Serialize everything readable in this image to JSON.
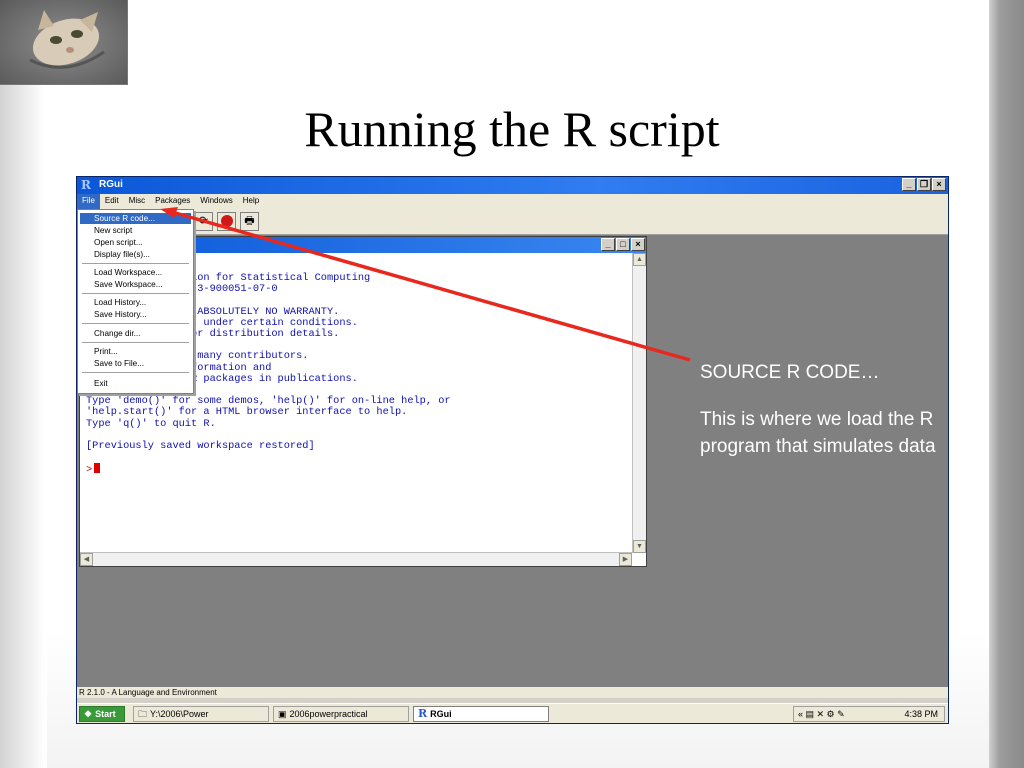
{
  "slide": {
    "title": "Running the R script",
    "annotation_heading": "SOURCE R CODE…",
    "annotation_body": "This is where we load the R program that simulates data"
  },
  "rgui": {
    "window_title": "RGui",
    "menubar": [
      "File",
      "Edit",
      "Misc",
      "Packages",
      "Windows",
      "Help"
    ],
    "file_menu": {
      "items": [
        {
          "label": "Source R code..."
        },
        {
          "label": "New script"
        },
        {
          "label": "Open script..."
        },
        {
          "label": "Display file(s)..."
        },
        {
          "label": "Load Workspace..."
        },
        {
          "label": "Save Workspace..."
        },
        {
          "label": "Load History..."
        },
        {
          "label": "Save History..."
        },
        {
          "label": "Change dir..."
        },
        {
          "label": "Print..."
        },
        {
          "label": "Save to File..."
        },
        {
          "label": "Exit"
        }
      ]
    },
    "console_lines": [
      "05, The R Foundation for Statistical Computing",
      "2005-04-18), ISBN 3-900051-07-0",
      "",
      "re and comes with ABSOLUTELY NO WARRANTY.",
      "to redistribute it under certain conditions.",
      " or 'licence()' for distribution details.",
      "",
      "tive project with many contributors.",
      "rs()' for more information and",
      "how to cite R or R packages in publications.",
      "",
      "Type 'demo()' for some demos, 'help()' for on-line help, or",
      "'help.start()' for a HTML browser interface to help.",
      "Type 'q()' to quit R.",
      "",
      "[Previously saved workspace restored]",
      ""
    ],
    "prompt": ">",
    "status_text": "R 2.1.0 - A Language and Environment"
  },
  "taskbar": {
    "start_label": "Start",
    "items": [
      {
        "label": "Y:\\2006\\Power"
      },
      {
        "label": "2006powerpractical"
      },
      {
        "label": "RGui"
      }
    ],
    "clock": "4:38 PM"
  },
  "colors": {
    "title_bar_blue": "#0a58d8",
    "menu_highlight": "#316ac5",
    "console_text": "#1010b0",
    "arrow_red": "#e8281e",
    "mdi_gray": "#808080"
  }
}
